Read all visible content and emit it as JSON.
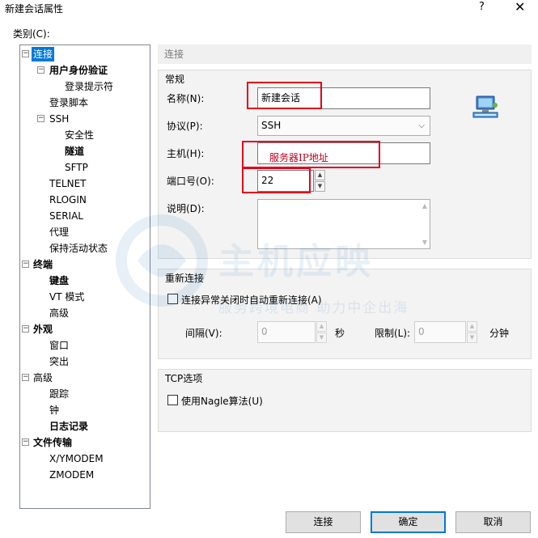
{
  "window": {
    "title": "新建会话属性",
    "help": "?",
    "close": "✕"
  },
  "category_label": "类别(C):",
  "tree": {
    "connection": "连接",
    "user_auth": "用户身份验证",
    "login_prompt": "登录提示符",
    "login_script": "登录脚本",
    "ssh": "SSH",
    "security": "安全性",
    "tunnel": "隧道",
    "sftp": "SFTP",
    "telnet": "TELNET",
    "rlogin": "RLOGIN",
    "serial": "SERIAL",
    "proxy": "代理",
    "keepalive": "保持活动状态",
    "terminal": "终端",
    "keyboard": "键盘",
    "vt_mode": "VT 模式",
    "advanced": "高级",
    "appearance": "外观",
    "window": "窗口",
    "highlight": "突出",
    "advanced2": "高级",
    "trace": "跟踪",
    "bell": "钟",
    "logging": "日志记录",
    "file_transfer": "文件传输",
    "xymodem": "X/YMODEM",
    "zmodem": "ZMODEM"
  },
  "breadcrumb": "连接",
  "general": {
    "title": "常规",
    "name_label": "名称(N):",
    "name_value": "新建会话",
    "protocol_label": "协议(P):",
    "protocol_value": "SSH",
    "host_label": "主机(H):",
    "host_hint": "服务器IP地址",
    "port_label": "端口号(O):",
    "port_value": "22",
    "desc_label": "说明(D):"
  },
  "reconnect": {
    "title": "重新连接",
    "auto_label": "连接异常关闭时自动重新连接(A)",
    "interval_label": "间隔(V):",
    "interval_value": "0",
    "sec_unit": "秒",
    "limit_label": "限制(L):",
    "limit_value": "0",
    "min_unit": "分钟"
  },
  "tcp": {
    "title": "TCP选项",
    "nagle_label": "使用Nagle算法(U)"
  },
  "buttons": {
    "connect": "连接",
    "ok": "确定",
    "cancel": "取消"
  },
  "watermark": {
    "text": "主机应映",
    "sub": "服务跨境电商  助力中企出海"
  },
  "colors": {
    "selected": "#0078d7",
    "highlight_box": "#e3001b"
  }
}
